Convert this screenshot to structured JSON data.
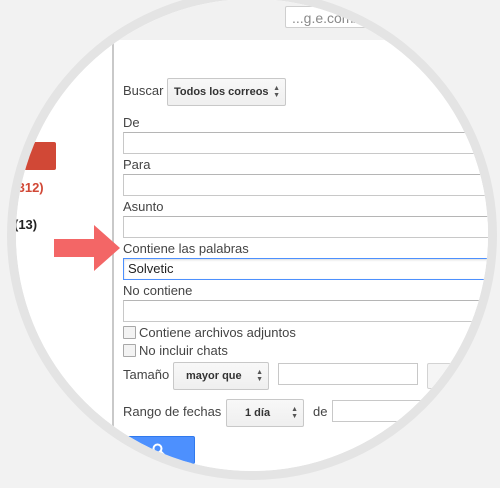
{
  "browser": {
    "address": "...g.e.com/mu..."
  },
  "left": {
    "inbox_count": ".312)",
    "other_count": "(13)"
  },
  "form": {
    "buscar_label": "Buscar",
    "buscar_value": "Todos los correos",
    "de_label": "De",
    "para_label": "Para",
    "asunto_label": "Asunto",
    "contiene_label": "Contiene las palabras",
    "contiene_value": "Solvetic",
    "no_contiene_label": "No contiene",
    "adjuntos_label": "Contiene archivos adjuntos",
    "no_chats_label": "No incluir chats",
    "tamano_label": "Tamaño",
    "tamano_value": "mayor que",
    "rango_label": "Rango de fechas",
    "rango_value": "1 día",
    "de_fecha_label": "de"
  },
  "colors": {
    "accent": "#4d90fe",
    "compose": "#d14836",
    "arrow": "#f36666"
  }
}
